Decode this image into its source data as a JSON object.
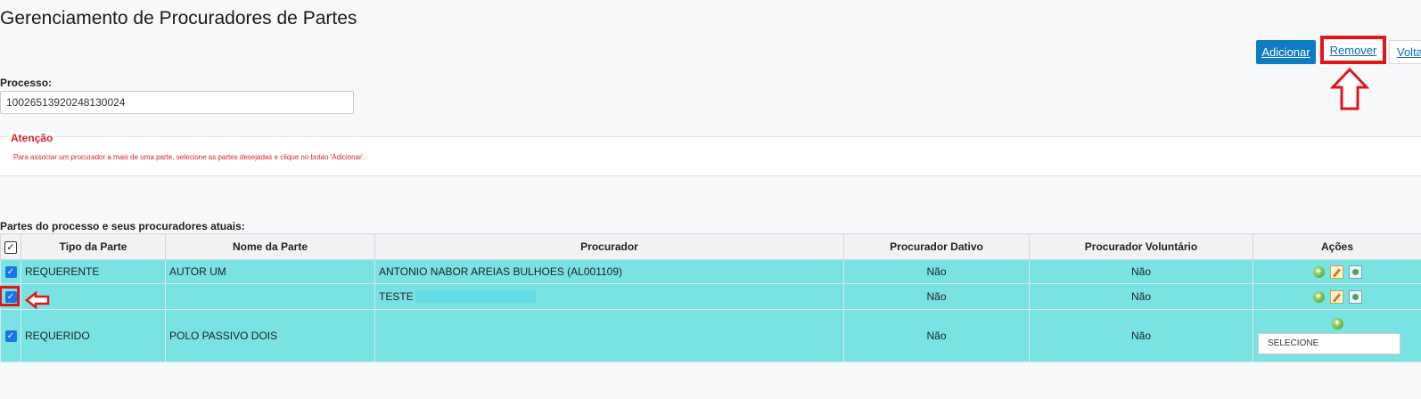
{
  "page": {
    "title": "Gerenciamento de Procuradores de Partes"
  },
  "toolbar": {
    "adicionar_label": "Adicionar",
    "remover_label": "Remover",
    "voltar_label": "Voltar"
  },
  "processo": {
    "label": "Processo:",
    "value": "10026513920248130024"
  },
  "attention": {
    "title": "Atenção",
    "text": "Para associar um procurador a mais de uma parte, selecione as partes desejadas e clique no botao 'Adicionar'."
  },
  "table": {
    "caption": "Partes do processo e seus procuradores atuais:",
    "headers": [
      "Tipo da Parte",
      "Nome da Parte",
      "Procurador",
      "Procurador Dativo",
      "Procurador Voluntário",
      "Ações"
    ],
    "rows": [
      {
        "checked": true,
        "tipo": "REQUERENTE",
        "nome": "AUTOR UM",
        "procurador": "ANTONIO NABOR AREIAS BULHOES (AL001109)",
        "dativo": "Não",
        "voluntario": "Não"
      },
      {
        "checked": true,
        "tipo": "",
        "nome": "",
        "procurador": "TESTE",
        "dativo": "Não",
        "voluntario": "Não"
      },
      {
        "checked": true,
        "tipo": "REQUERIDO",
        "nome": "POLO PASSIVO DOIS",
        "procurador": "",
        "dativo": "Não",
        "voluntario": "Não",
        "select_value": "SELECIONE"
      }
    ]
  },
  "colors": {
    "primary_button": "#0e7cc2",
    "annotation_red": "#e0161b",
    "row_highlight": "#79e3e3",
    "attention_red": "#d9232e"
  }
}
